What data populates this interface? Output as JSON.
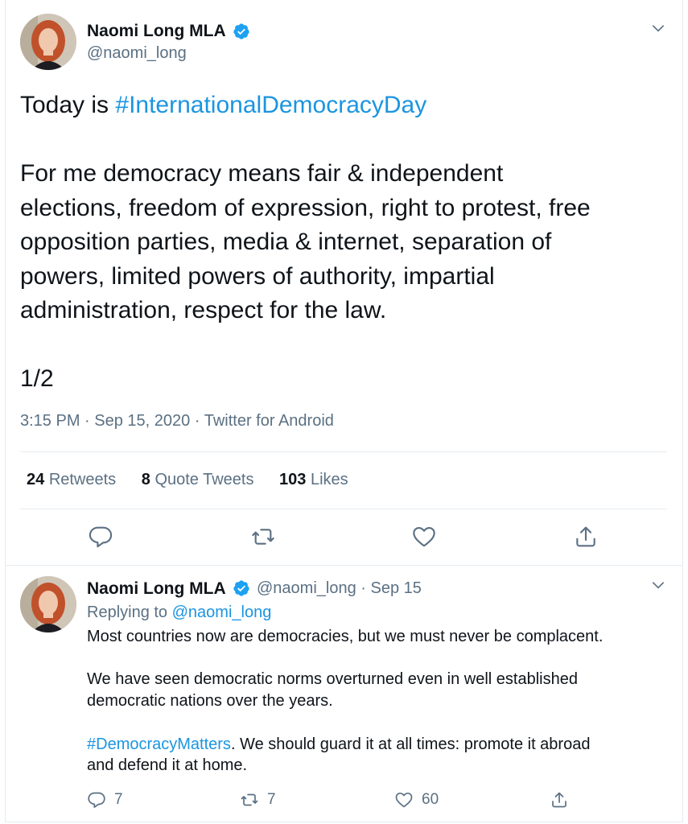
{
  "tweet": {
    "author_name": "Naomi Long MLA",
    "handle": "@naomi_long",
    "text_prefix": "Today is ",
    "hashtag": "#InternationalDemocracyDay",
    "text_body": "\n\nFor me democracy means fair & independent\nelections, freedom of expression, right to protest, free\nopposition parties, media & internet, separation of\npowers, limited powers of authority, impartial\nadministration, respect for the law.\n\n1/2",
    "time": "3:15 PM",
    "date": "Sep 15, 2020",
    "source": "Twitter for Android",
    "separator": "·",
    "stats": {
      "retweets_count": "24",
      "retweets_label": "Retweets",
      "quotes_count": "8",
      "quotes_label": "Quote Tweets",
      "likes_count": "103",
      "likes_label": "Likes"
    }
  },
  "reply": {
    "author_name": "Naomi Long MLA",
    "handle_date": "@naomi_long · Sep 15",
    "replying_to_label": "Replying to ",
    "replying_to_handle": "@naomi_long",
    "text_before": "Most countries now are democracies, but we must never be complacent.\n\nWe have seen democratic norms overturned even in well established\ndemocratic nations over the years.\n\n",
    "hashtag": "#DemocracyMatters",
    "text_after": ". We should guard it at all times: promote it abroad\nand defend it at home.",
    "reply_count": "7",
    "retweet_count": "7",
    "like_count": "60"
  },
  "icons": {
    "verified": "verified-badge-icon",
    "caret": "chevron-down-icon",
    "reply": "reply-icon",
    "retweet": "retweet-icon",
    "like": "heart-icon",
    "share": "share-icon"
  },
  "colors": {
    "link": "#1b95e0",
    "secondary_text": "#5b7083",
    "divider": "#e6ecf0"
  }
}
